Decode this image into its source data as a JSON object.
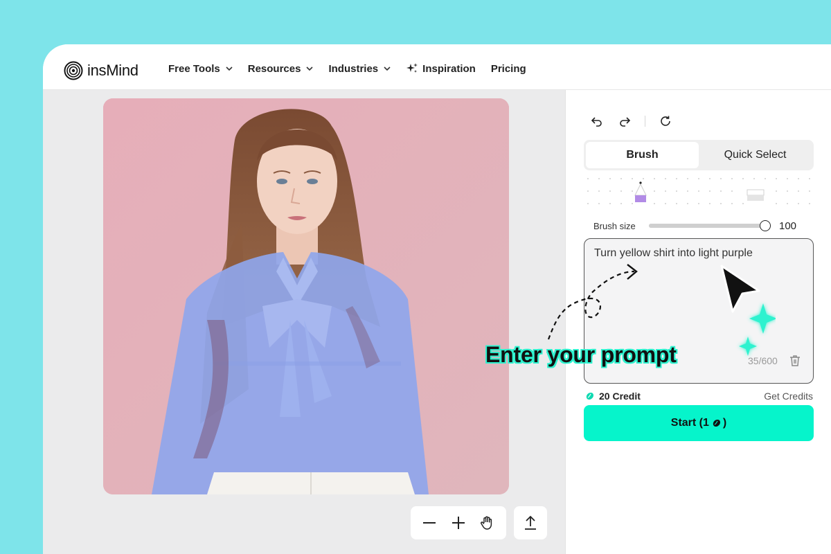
{
  "brand": {
    "name": "insMind"
  },
  "nav": {
    "items": [
      {
        "label": "Free Tools",
        "has_dropdown": true
      },
      {
        "label": "Resources",
        "has_dropdown": true
      },
      {
        "label": "Industries",
        "has_dropdown": true
      },
      {
        "label": "Inspiration",
        "icon": "sparkle-icon"
      },
      {
        "label": "Pricing"
      }
    ]
  },
  "panel": {
    "tabs": [
      {
        "label": "Brush",
        "active": true
      },
      {
        "label": "Quick Select",
        "active": false
      }
    ],
    "brush_size": {
      "label": "Brush size",
      "value": "100",
      "fraction": 1.0
    },
    "prompt": {
      "text": "Turn yellow shirt into light purple",
      "counter": "35/600"
    },
    "credits": {
      "label": "20 Credit",
      "get_label": "Get Credits"
    },
    "start": {
      "label": "Start (1",
      "suffix": ")"
    }
  },
  "annotation": {
    "text": "Enter your prompt"
  },
  "colors": {
    "background": "#7ee4ea",
    "accent": "#06f4cb",
    "mask": "#8fa6ec",
    "photo_bg": "#e3b4bd"
  }
}
